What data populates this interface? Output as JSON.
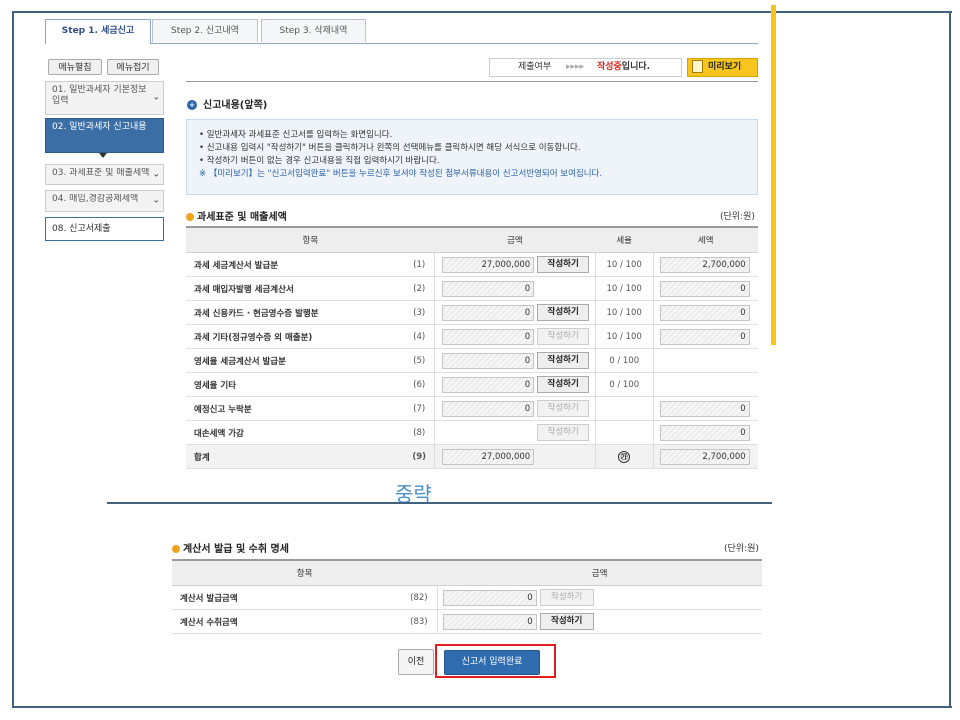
{
  "tabs": [
    {
      "label": "Step 1. 세금신고"
    },
    {
      "label": "Step 2. 신고내역"
    },
    {
      "label": "Step 3. 삭제내역"
    }
  ],
  "side_buttons": {
    "expand": "메뉴펼침",
    "collapse": "메뉴접기"
  },
  "sidebar": [
    {
      "label": "01. 일반과세자 기본정보 입력"
    },
    {
      "label": "02. 일반과세자 신고내용"
    },
    {
      "label": "03. 과세표준 및 매출세액"
    },
    {
      "label": "04. 매입,경감공제세액"
    },
    {
      "label": "08. 신고서제출"
    }
  ],
  "status": {
    "label": "제출여부",
    "arrows": "▸▸▸▸",
    "value": "작성중",
    "suffix": "입니다."
  },
  "preview_label": "미리보기",
  "section_title": "신고내용(앞쪽)",
  "info_lines": [
    "일반과세자 과세표준 신고서를 입력하는 화면입니다.",
    "신고내용 입력시 \"작성하기\" 버튼을 클릭하거나 왼쪽의 선택메뉴를 클릭하시면 해당 서식으로 이동합니다.",
    "작성하기 버튼이 없는 경우 신고내용을 직접 입력하시기 바랍니다."
  ],
  "info_note": "※ 【미리보기】는 \"신고서입력완료\" 버튼을 누르신후 보셔야 작성된 첨부서류내용이 신고서반영되어 보여집니다.",
  "table1": {
    "title": "과세표준 및 매출세액",
    "unit": "(단위:원)",
    "headers": [
      "항목",
      "금액",
      "세율",
      "세액"
    ],
    "write_label": "작성하기",
    "rows": [
      {
        "label": "과세 세금계산서 발급분",
        "num": "(1)",
        "amount": "27,000,000",
        "rate": "10 / 100",
        "tax": "2,700,000"
      },
      {
        "label": "과세 매입자발행 세금계산서",
        "num": "(2)",
        "amount": "0",
        "rate": "10 / 100",
        "tax": "0"
      },
      {
        "label": "과세 신용카드 · 현금영수증 발행분",
        "num": "(3)",
        "amount": "0",
        "rate": "10 / 100",
        "tax": "0"
      },
      {
        "label": "과세 기타(정규영수증 외 매출분)",
        "num": "(4)",
        "amount": "0",
        "rate": "10 / 100",
        "tax": "0"
      },
      {
        "label": "영세율 세금계산서 발급분",
        "num": "(5)",
        "amount": "0",
        "rate": "0 / 100",
        "tax": ""
      },
      {
        "label": "영세율 기타",
        "num": "(6)",
        "amount": "0",
        "rate": "0 / 100",
        "tax": ""
      },
      {
        "label": "예정신고 누락분",
        "num": "(7)",
        "amount": "0",
        "rate": "",
        "tax": "0"
      },
      {
        "label": "대손세액 가감",
        "num": "(8)",
        "amount": "",
        "rate": "",
        "tax": "0"
      }
    ],
    "total": {
      "label": "합계",
      "num": "(9)",
      "amount": "27,000,000",
      "circle": "㉮",
      "tax": "2,700,000"
    }
  },
  "omitted_label": "중략",
  "table2": {
    "title": "계산서 발급 및 수취 명세",
    "unit": "(단위:원)",
    "headers": [
      "항목",
      "금액"
    ],
    "rows": [
      {
        "label": "계산서 발급금액",
        "num": "(82)",
        "amount": "0"
      },
      {
        "label": "계산서 수취금액",
        "num": "(83)",
        "amount": "0"
      }
    ]
  },
  "buttons": {
    "prev": "이전",
    "submit": "신고서 입력완료"
  }
}
